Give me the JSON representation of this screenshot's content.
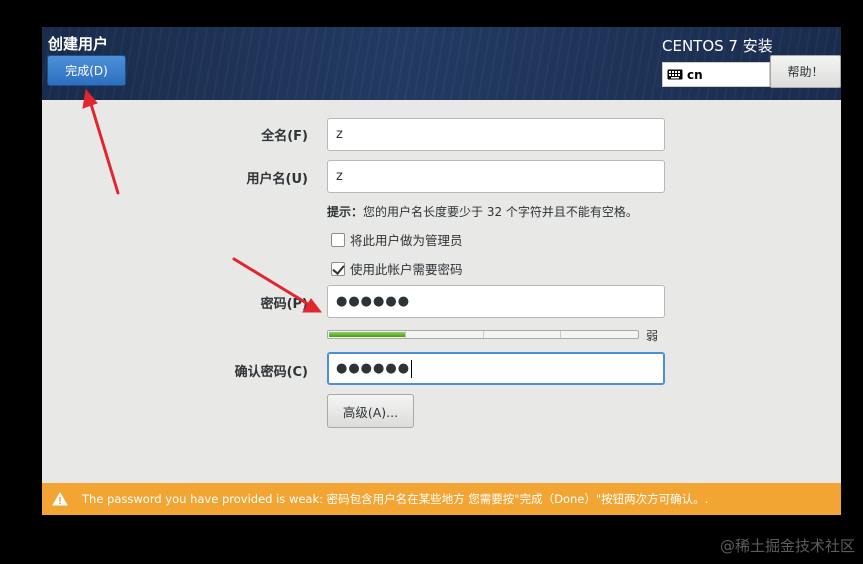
{
  "header": {
    "title": "创建用户",
    "done_label": "完成(D)",
    "install_title": "CENTOS 7 安装",
    "keyboard_layout": "cn",
    "help_label": "帮助！"
  },
  "form": {
    "fullname_label": "全名(F)",
    "fullname_value": "z",
    "username_label": "用户名(U)",
    "username_value": "z",
    "hint_prefix": "提示：",
    "hint_text": "您的用户名长度要少于 32 个字符并且不能有空格。",
    "admin_checkbox_label": "将此用户做为管理员",
    "admin_checked": false,
    "require_password_label": "使用此帐户需要密码",
    "require_password_checked": true,
    "password_label": "密码(P)",
    "password_value": "●●●●●●",
    "strength_label": "弱",
    "strength_level": 0.25,
    "confirm_label": "确认密码(C)",
    "confirm_value": "●●●●●●",
    "advanced_label": "高级(A)..."
  },
  "warning": {
    "text": "The password you have provided is weak: 密码包含用户名在某些地方 您需要按\"完成（Done）\"按钮两次方可确认。."
  },
  "watermark": "@稀土掘金技术社区",
  "colors": {
    "header_bg": "#1f3358",
    "done_button": "#3b7fcf",
    "warning_bg": "#f2a533",
    "strength_fill": "#4e9a06",
    "arrow": "#e0262e"
  },
  "icons": {
    "keyboard": "keyboard-icon",
    "warning": "warning-icon",
    "checkmark": "checkmark-icon"
  }
}
